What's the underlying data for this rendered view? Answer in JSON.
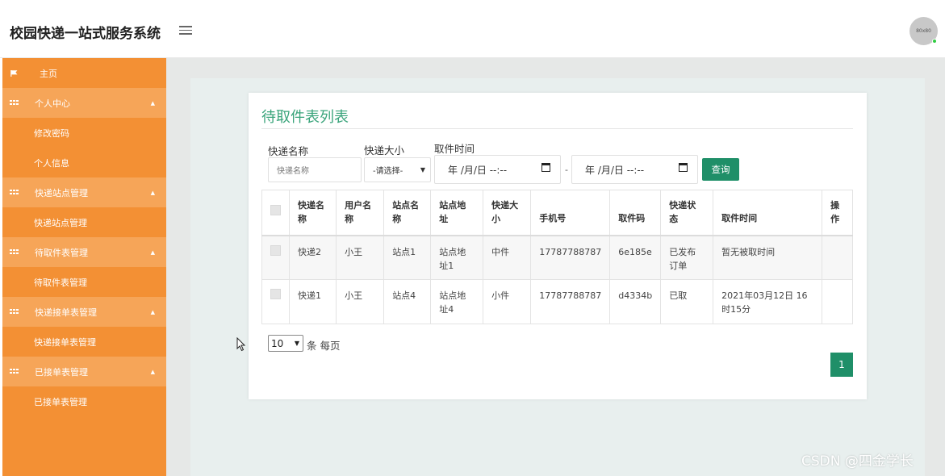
{
  "header": {
    "app_title": "校园快递一站式服务系统",
    "avatar_text": "80x80"
  },
  "sidebar": {
    "home": "主页",
    "groups": [
      {
        "label": "个人中心",
        "children": [
          "修改密码",
          "个人信息"
        ]
      },
      {
        "label": "快递站点管理",
        "children": [
          "快递站点管理"
        ]
      },
      {
        "label": "待取件表管理",
        "children": [
          "待取件表管理"
        ]
      },
      {
        "label": "快递接单表管理",
        "children": [
          "快递接单表管理"
        ]
      },
      {
        "label": "已接单表管理",
        "children": [
          "已接单表管理"
        ]
      }
    ]
  },
  "main": {
    "title": "待取件表列表",
    "filters": {
      "name_label": "快递名称",
      "name_placeholder": "快递名称",
      "size_label": "快递大小",
      "size_value": "-请选择-",
      "time_label": "取件时间",
      "date_start": "年 /月/日 --:--",
      "date_end": "年 /月/日 --:--",
      "separator": "-",
      "query_button": "查询"
    },
    "table": {
      "headers": [
        "快递名称",
        "用户名称",
        "站点名称",
        "站点地址",
        "快递大小",
        "手机号",
        "取件码",
        "快递状态",
        "取件时间",
        "操作"
      ],
      "rows": [
        [
          "快递2",
          "小王",
          "站点1",
          "站点地址1",
          "中件",
          "17787788787",
          "6e185e",
          "已发布订单",
          "暂无被取时间",
          ""
        ],
        [
          "快递1",
          "小王",
          "站点4",
          "站点地址4",
          "小件",
          "17787788787",
          "d4334b",
          "已取",
          "2021年03月12日 16时15分",
          ""
        ]
      ]
    },
    "pagination": {
      "page_size": "10",
      "page_size_label": "条 每页",
      "current_page": "1"
    }
  },
  "watermark": "CSDN @四金学长",
  "colors": {
    "sidebar": "#f39034",
    "sidebar_group": "#f6a558",
    "accent": "#1f8f68",
    "title": "#3aa47b"
  }
}
